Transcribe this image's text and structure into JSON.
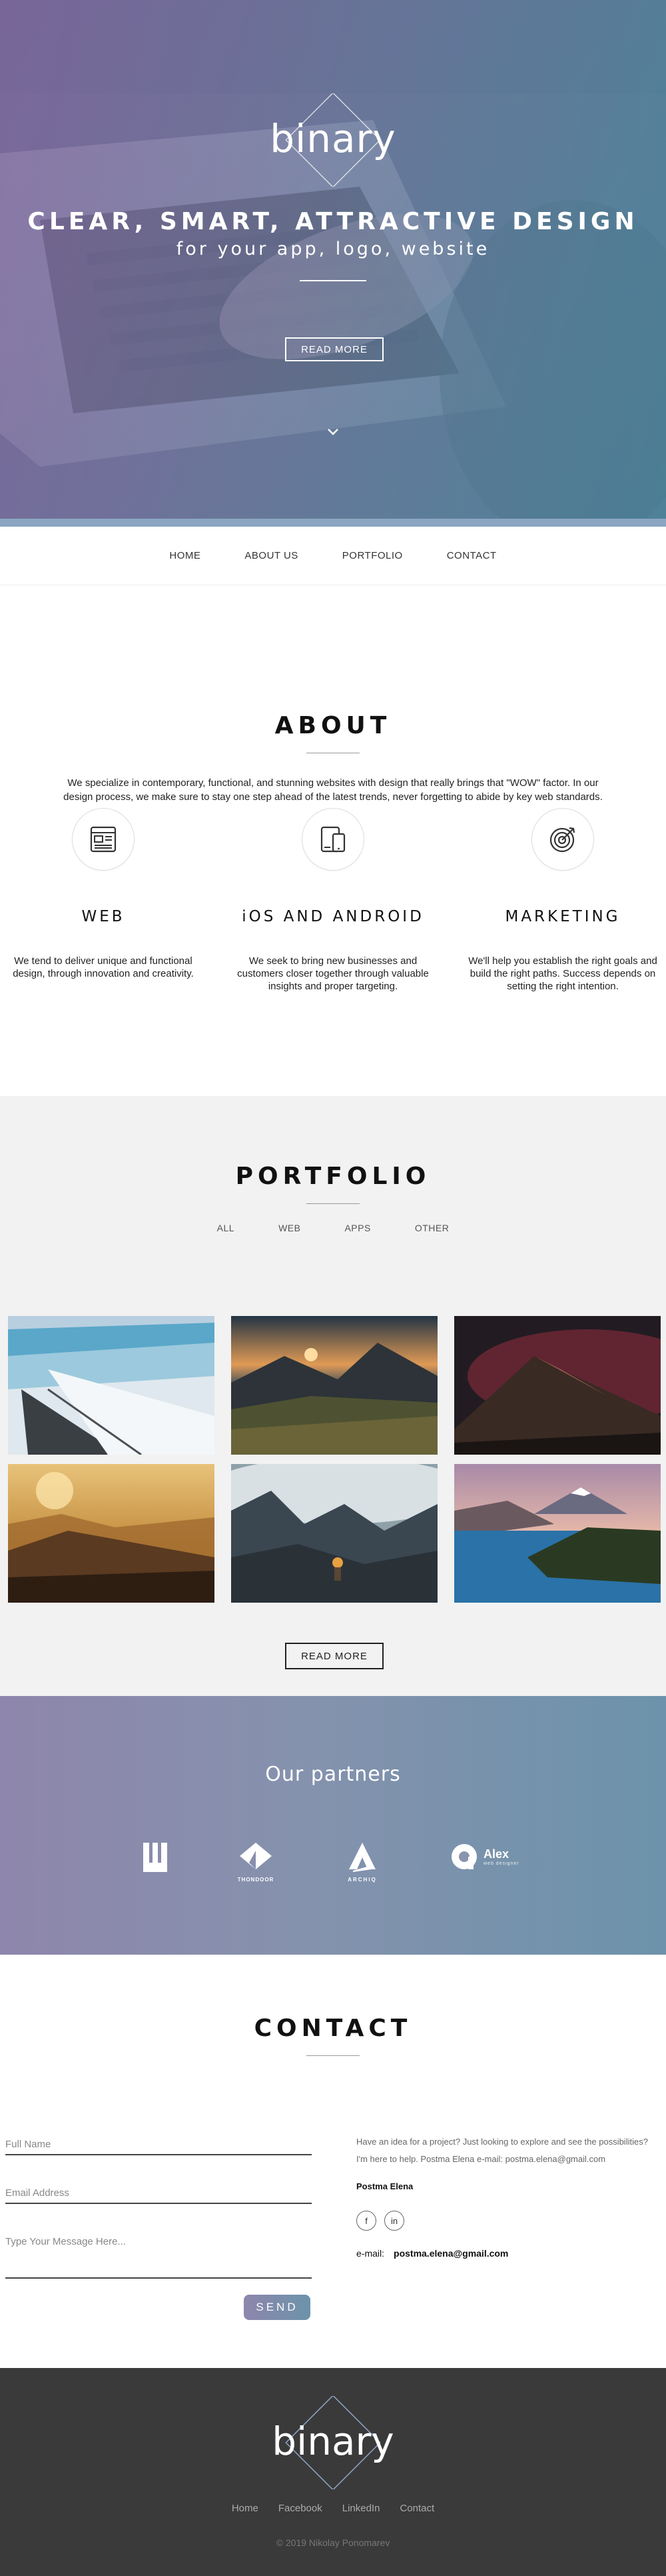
{
  "brand": {
    "logo_text": "binary"
  },
  "hero": {
    "title": "CLEAR, SMART, ATTRACTIVE DESIGN",
    "subtitle": "for your app, logo, website",
    "button": "READ MORE"
  },
  "nav": {
    "items": [
      "HOME",
      "ABOUT US",
      "PORTFOLIO",
      "CONTACT"
    ]
  },
  "about": {
    "title": "ABOUT",
    "text": "We specialize in contemporary, functional, and stunning websites with design that really brings that \"WOW\" factor. In our design process, we make sure to stay one step ahead of the latest trends, never forgetting to abide by key web standards.",
    "services": [
      {
        "icon": "web-layout-icon",
        "title": "WEB",
        "text": "We tend to deliver unique and functional design, through innovation and creativity."
      },
      {
        "icon": "devices-icon",
        "title": "iOS AND ANDROID",
        "text": "We seek to bring new businesses and customers closer together through valuable insights and proper targeting."
      },
      {
        "icon": "target-icon",
        "title": "MARKETING",
        "text": "We'll help you establish the right goals and build the right paths. Success depends on setting the right intention."
      }
    ]
  },
  "portfolio": {
    "title": "PORTFOLIO",
    "filters": [
      "ALL",
      "WEB",
      "APPS",
      "OTHER"
    ],
    "button": "READ MORE"
  },
  "partners": {
    "title": "Our partners",
    "logos": [
      {
        "name": "w-brand-logo",
        "text": ""
      },
      {
        "name": "thondoor-logo",
        "text": "THONDOOR"
      },
      {
        "name": "archiq-logo",
        "text": "ARCHIQ"
      },
      {
        "name": "alex-logo",
        "text": "Alex",
        "sub": "web designer"
      }
    ]
  },
  "contact": {
    "title": "CONTACT",
    "fields": {
      "name_placeholder": "Full Name",
      "email_placeholder": "Email Address",
      "message_placeholder": "Type Your Message Here..."
    },
    "send": "SEND",
    "info_line1": "Have an idea for a project? Just looking to explore and see the possibilities?",
    "info_line2": "I'm here to help. Postma Elena e-mail: postma.elena@gmail.com",
    "name": "Postma Elena",
    "email_label": "e-mail:",
    "email": "postma.elena@gmail.com"
  },
  "footer": {
    "links": [
      "Home",
      "Facebook",
      "LinkedIn",
      "Contact"
    ],
    "copyright": "© 2019 Nikolay Ponomarev"
  },
  "colors": {
    "accent_start": "#8e86ac",
    "accent_end": "#6c93ab",
    "footer_bg": "#3a3a3a"
  }
}
